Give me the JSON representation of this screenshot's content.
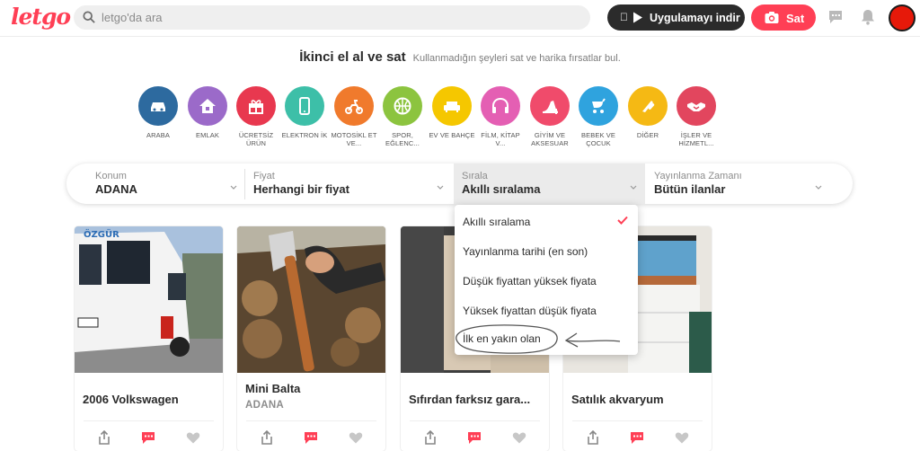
{
  "header": {
    "logo": "letgo",
    "search_placeholder": "letgo'da ara",
    "app_button": "Uygulamayı indir",
    "sell_button": "Sat"
  },
  "hero": {
    "title": "İkinci el al ve sat",
    "subtitle": "Kullanmadığın şeyleri sat ve harika fırsatlar bul."
  },
  "categories": [
    {
      "label": "ARABA",
      "color": "#2d6a9f"
    },
    {
      "label": "EMLAK",
      "color": "#9b6ac9"
    },
    {
      "label": "ÜCRETSİZ ÜRÜN",
      "color": "#e8384f"
    },
    {
      "label": "ELEKTRON İK",
      "color": "#3dbfa8"
    },
    {
      "label": "MOTOSİKL ET VE...",
      "color": "#f07a2c"
    },
    {
      "label": "SPOR, EĞLENC...",
      "color": "#8cc43f"
    },
    {
      "label": "EV VE BAHÇE",
      "color": "#f5c700"
    },
    {
      "label": "FİLM, KİTAP V...",
      "color": "#e45fb3"
    },
    {
      "label": "GİYİM VE AKSESUAR",
      "color": "#f04b6b"
    },
    {
      "label": "BEBEK VE ÇOCUK",
      "color": "#2fa3de"
    },
    {
      "label": "DİĞER",
      "color": "#f5b914"
    },
    {
      "label": "İŞLER VE HİZMETL...",
      "color": "#e2465e"
    }
  ],
  "filters": {
    "location": {
      "label": "Konum",
      "value": "ADANA"
    },
    "price": {
      "label": "Fiyat",
      "value": "Herhangi bir fiyat"
    },
    "sort": {
      "label": "Sırala",
      "value": "Akıllı sıralama"
    },
    "date": {
      "label": "Yayınlanma Zamanı",
      "value": "Bütün ilanlar"
    }
  },
  "sort_options": [
    "Akıllı sıralama",
    "Yayınlanma tarihi (en son)",
    "Düşük fiyattan yüksek fiyata",
    "Yüksek fiyattan düşük fiyata",
    "İlk en yakın olan"
  ],
  "listings": [
    {
      "title": "2006 Volkswagen",
      "location": ""
    },
    {
      "title": "Mini Balta",
      "location": "ADANA"
    },
    {
      "title": "Sıfırdan farksız gara...",
      "location": ""
    },
    {
      "title": "Satılık akvaryum",
      "location": ""
    }
  ],
  "colors": {
    "brand": "#ff3f55",
    "dark": "#2b2b2b"
  }
}
